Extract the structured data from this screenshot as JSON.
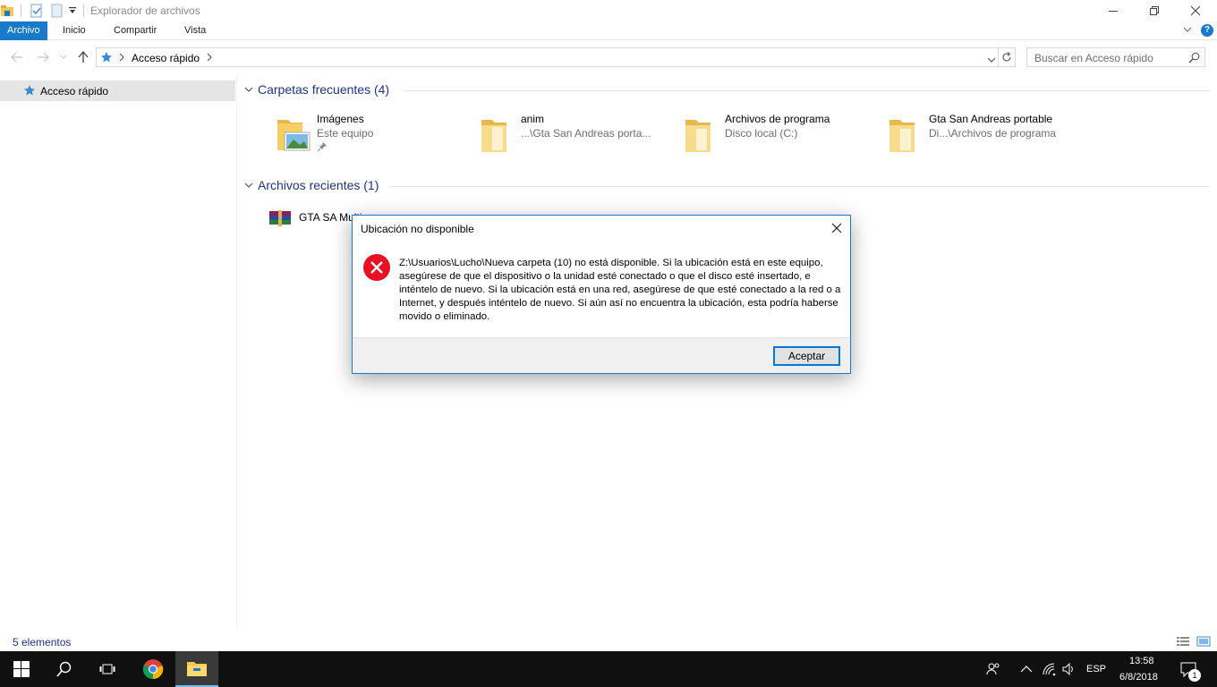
{
  "window": {
    "title": "Explorador de archivos"
  },
  "ribbon": {
    "tabs": [
      {
        "label": "Archivo",
        "active": true
      },
      {
        "label": "Inicio",
        "active": false
      },
      {
        "label": "Compartir",
        "active": false
      },
      {
        "label": "Vista",
        "active": false
      }
    ],
    "help_label": "?"
  },
  "navbar": {
    "address": "Acceso rápido",
    "search_placeholder": "Buscar en Acceso rápido"
  },
  "sidebar": {
    "items": [
      {
        "label": "Acceso rápido",
        "icon": "star-icon",
        "selected": true
      }
    ]
  },
  "content": {
    "frequent_title": "Carpetas frecuentes (4)",
    "folders": [
      {
        "name": "Imágenes",
        "location": "Este equipo",
        "icon": "pictures-folder-icon",
        "pinned": true
      },
      {
        "name": "anim",
        "location": "...\\Gta San Andreas porta...",
        "icon": "folder-icon",
        "pinned": false
      },
      {
        "name": "Archivos de programa",
        "location": "Disco local (C:)",
        "icon": "folder-icon",
        "pinned": false
      },
      {
        "name": "Gta San Andreas portable",
        "location": "Di...\\Archivos de programa",
        "icon": "folder-icon",
        "pinned": false
      }
    ],
    "recent_title": "Archivos recientes (1)",
    "recent_files": [
      {
        "name": "GTA SA Multi",
        "icon": "winrar-archive-icon"
      }
    ]
  },
  "status": {
    "item_count": "5 elementos"
  },
  "dialog": {
    "title": "Ubicación no disponible",
    "message": "Z:\\Usuarios\\Lucho\\Nueva carpeta (10) no está disponible. Si la ubicación está en este equipo, asegúrese de que el dispositivo o la unidad esté conectado o que el disco esté insertado, e inténtelo de nuevo. Si la ubicación está en una red, asegúrese de que esté conectado a la red o a Internet, y después inténtelo de nuevo. Si aún así no encuentra la ubicación, esta podría haberse movido o eliminado.",
    "ok_label": "Aceptar",
    "icon": "error-icon"
  },
  "taskbar": {
    "language": "ESP",
    "time": "13:58",
    "date": "6/8/2018",
    "notification_count": "1"
  },
  "colors": {
    "accent": "#1979ca",
    "section_title": "#1e3287",
    "error": "#e81123",
    "taskbar": "#101010"
  }
}
